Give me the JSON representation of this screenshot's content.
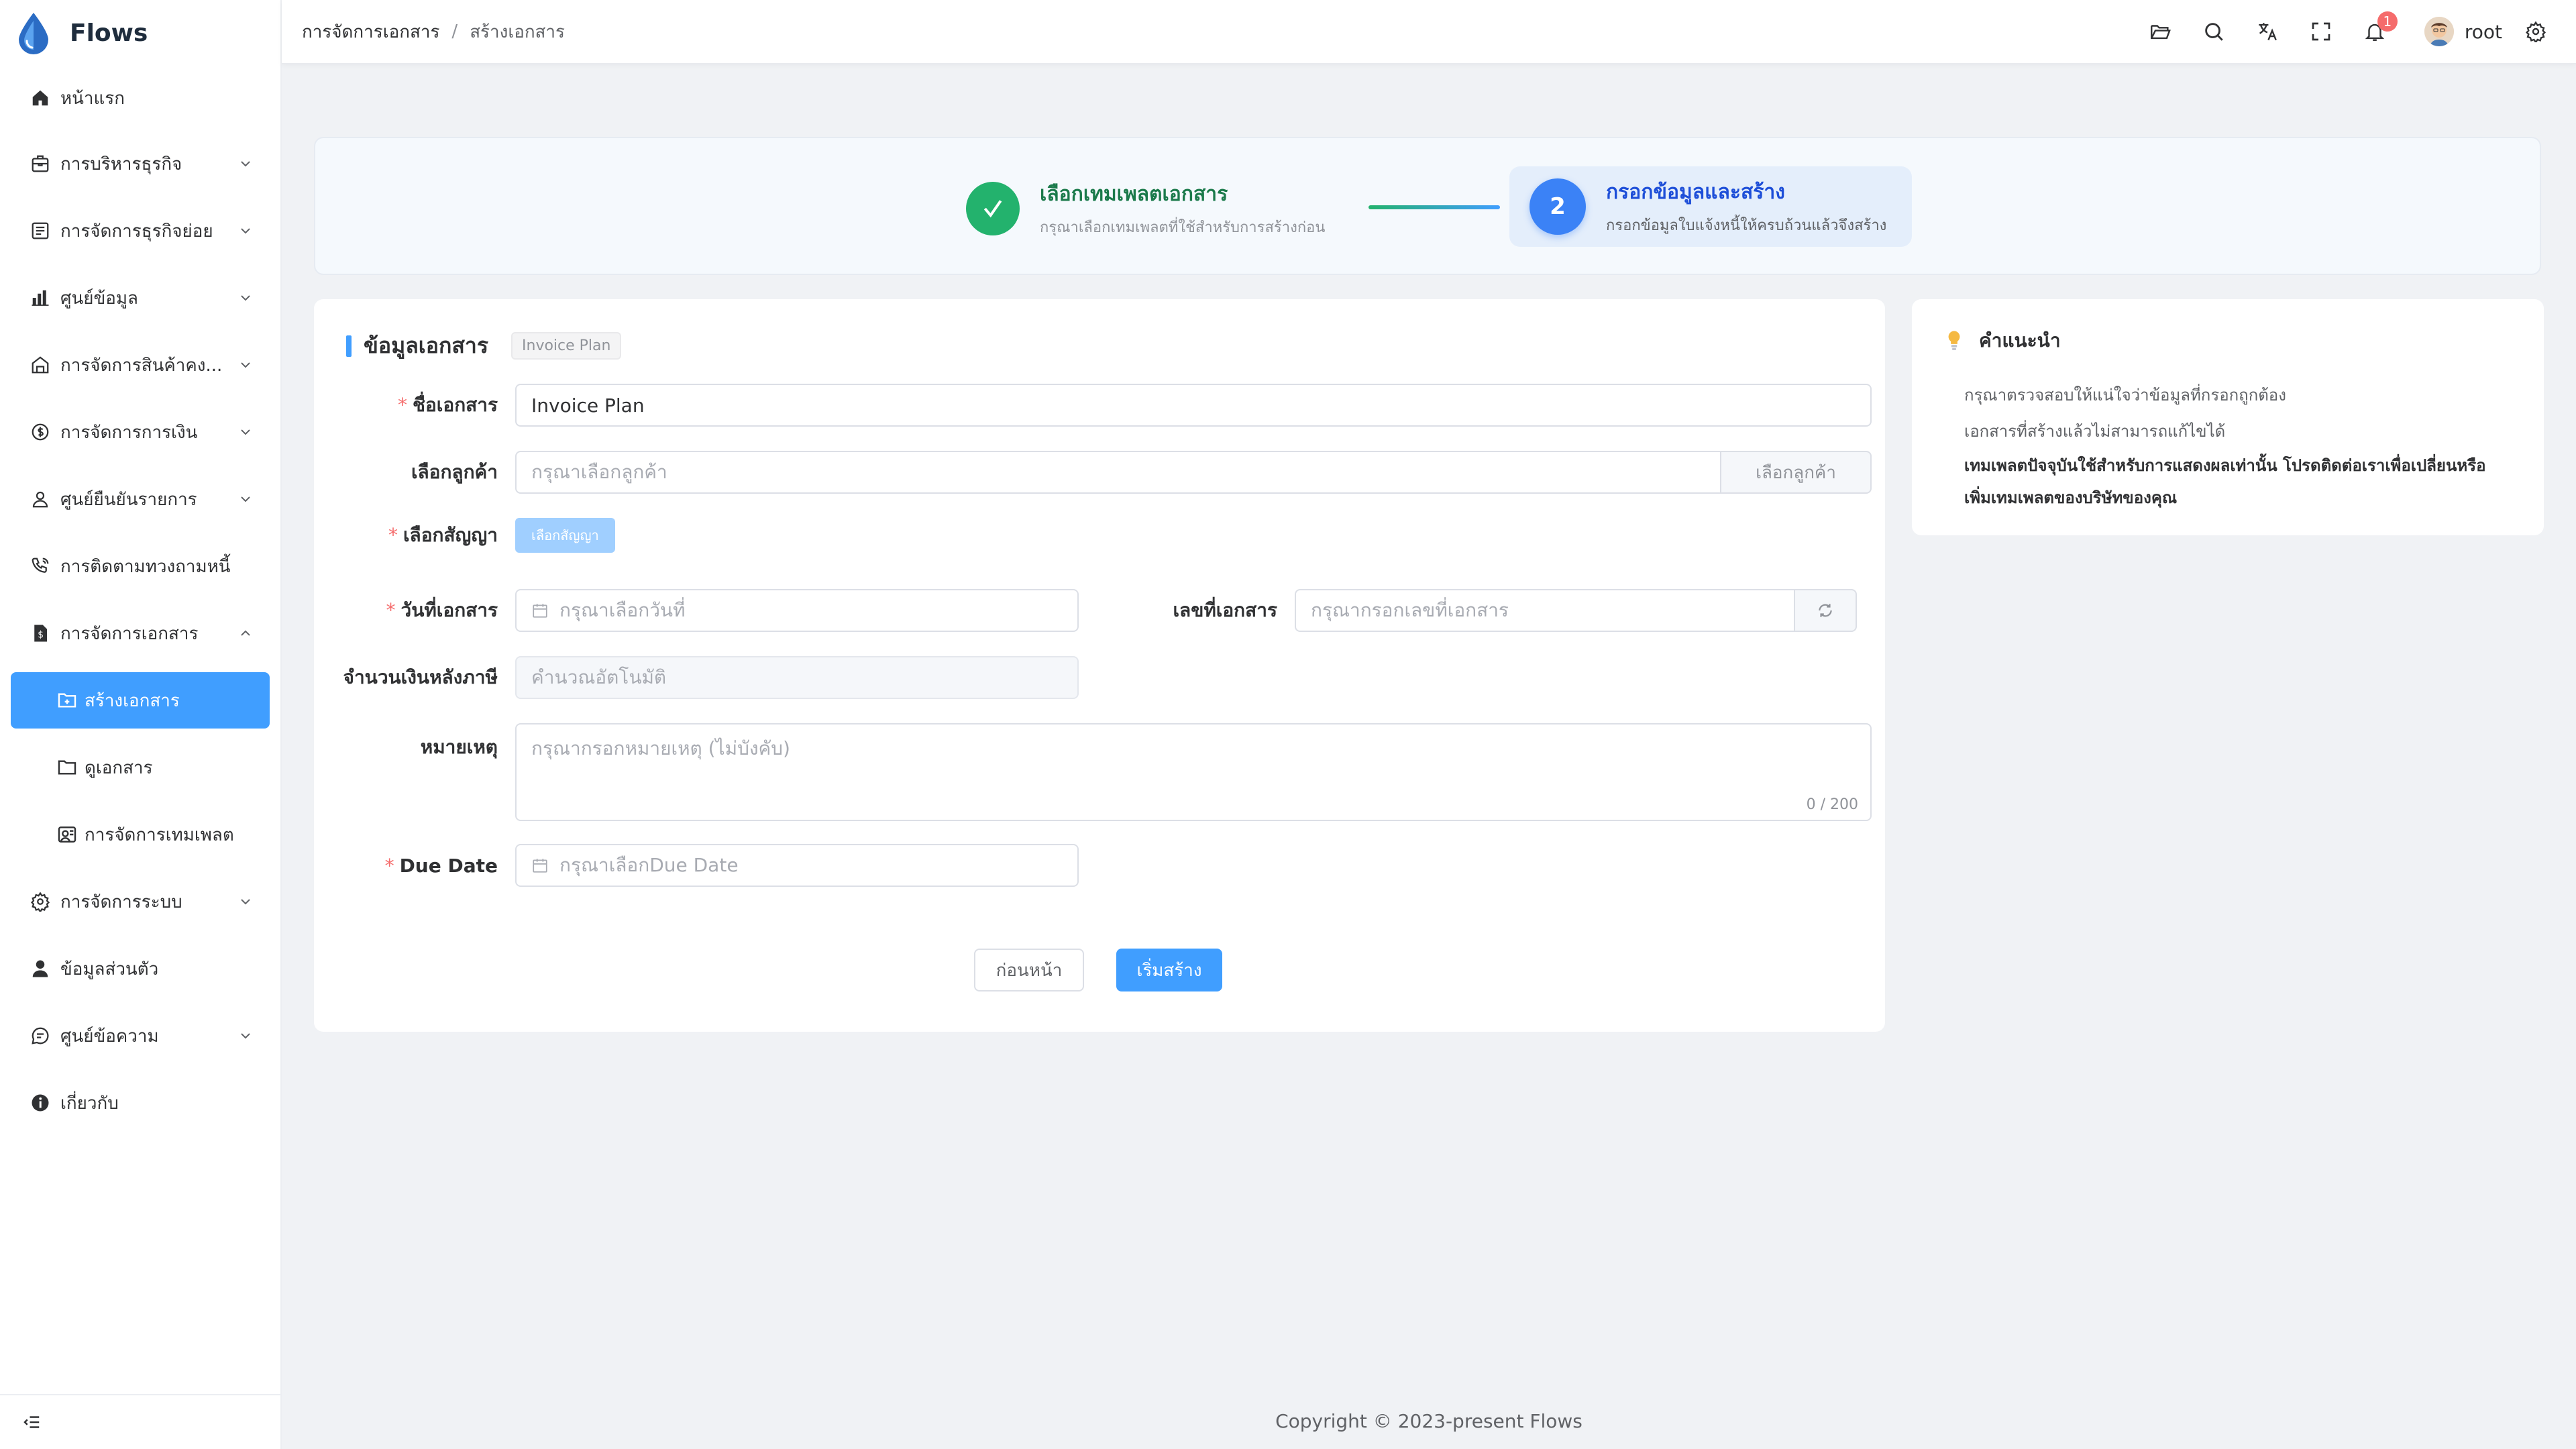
{
  "app": {
    "name": "Flows"
  },
  "sidebar": {
    "items": [
      {
        "label": "หน้าแรก",
        "icon": "home-icon",
        "has_children": false
      },
      {
        "label": "การบริหารธุรกิจ",
        "icon": "briefcase-icon",
        "has_children": true
      },
      {
        "label": "การจัดการธุรกิจย่อย",
        "icon": "document-list-icon",
        "has_children": true
      },
      {
        "label": "ศูนย์ข้อมูล",
        "icon": "bar-chart-icon",
        "has_children": true
      },
      {
        "label": "การจัดการสินค้าคง...",
        "icon": "warehouse-icon",
        "has_children": true
      },
      {
        "label": "การจัดการการเงิน",
        "icon": "money-circle-icon",
        "has_children": true
      },
      {
        "label": "ศูนย์ยืนยันรายการ",
        "icon": "user-check-icon",
        "has_children": true
      },
      {
        "label": "การติดตามทวงถามหนี้",
        "icon": "phone-call-icon",
        "has_children": false
      },
      {
        "label": "การจัดการเอกสาร",
        "icon": "document-dollar-icon",
        "has_children": true,
        "expanded": true
      }
    ],
    "sub_items": [
      {
        "label": "สร้างเอกสาร",
        "icon": "folder-add-icon",
        "active": true
      },
      {
        "label": "ดูเอกสาร",
        "icon": "folder-icon",
        "active": false
      },
      {
        "label": "การจัดการเทมเพลต",
        "icon": "template-icon",
        "active": false
      }
    ],
    "items_after": [
      {
        "label": "การจัดการระบบ",
        "icon": "gear-icon",
        "has_children": true
      },
      {
        "label": "ข้อมูลส่วนตัว",
        "icon": "user-icon",
        "has_children": false
      },
      {
        "label": "ศูนย์ข้อความ",
        "icon": "chat-icon",
        "has_children": true
      },
      {
        "label": "เกี่ยวกับ",
        "icon": "info-icon",
        "has_children": false
      }
    ]
  },
  "header": {
    "breadcrumb": [
      "การจัดการเอกสาร",
      "สร้างเอกสาร"
    ],
    "breadcrumb_sep": "/",
    "notification_count": "1",
    "username": "root"
  },
  "steps": {
    "step1": {
      "title": "เลือกเทมเพลตเอกสาร",
      "desc": "กรุณาเลือกเทมเพลตที่ใช้สำหรับการสร้างก่อน",
      "status": "done"
    },
    "step2": {
      "number": "2",
      "title": "กรอกข้อมูลและสร้าง",
      "desc": "กรอกข้อมูลใบแจ้งหนี้ให้ครบถ้วนแล้วจึงสร้าง",
      "status": "current"
    }
  },
  "form": {
    "section_title": "ข้อมูลเอกสาร",
    "template_tag": "Invoice Plan",
    "doc_name": {
      "label": "ชื่อเอกสาร",
      "value": "Invoice Plan",
      "required": true
    },
    "customer": {
      "label": "เลือกลูกค้า",
      "placeholder": "กรุณาเลือกลูกค้า",
      "button": "เลือกลูกค้า"
    },
    "contract": {
      "label": "เลือกสัญญา",
      "button": "เลือกสัญญา",
      "required": true
    },
    "doc_date": {
      "label": "วันที่เอกสาร",
      "placeholder": "กรุณาเลือกวันที่",
      "required": true
    },
    "doc_no": {
      "label": "เลขที่เอกสาร",
      "placeholder": "กรุณากรอกเลขที่เอกสาร"
    },
    "amount_after_tax": {
      "label": "จำนวนเงินหลังภาษี",
      "placeholder": "คำนวณอัตโนมัติ"
    },
    "remark": {
      "label": "หมายเหตุ",
      "placeholder": "กรุณากรอกหมายเหตุ (ไม่บังคับ)",
      "counter": "0 / 200"
    },
    "due_date": {
      "label": "Due Date",
      "placeholder": "กรุณาเลือกDue Date",
      "required": true
    },
    "prev_button": "ก่อนหน้า",
    "submit_button": "เริ่มสร้าง",
    "required_mark": "*"
  },
  "tips": {
    "title": "คำแนะนำ",
    "items": [
      "กรุณาตรวจสอบให้แน่ใจว่าข้อมูลที่กรอกถูกต้อง",
      "เอกสารที่สร้างแล้วไม่สามารถแก้ไขได้",
      "เทมเพลตปัจจุบันใช้สำหรับการแสดงผลเท่านั้น โปรดติดต่อเราเพื่อเปลี่ยนหรือเพิ่มเทมเพลตของบริษัทของคุณ"
    ]
  },
  "footer": {
    "copyright": "Copyright © 2023-present Flows"
  },
  "colors": {
    "primary": "#409eff",
    "success": "#23b26d",
    "danger": "#f56c6c",
    "step_active": "#3b82f6"
  }
}
